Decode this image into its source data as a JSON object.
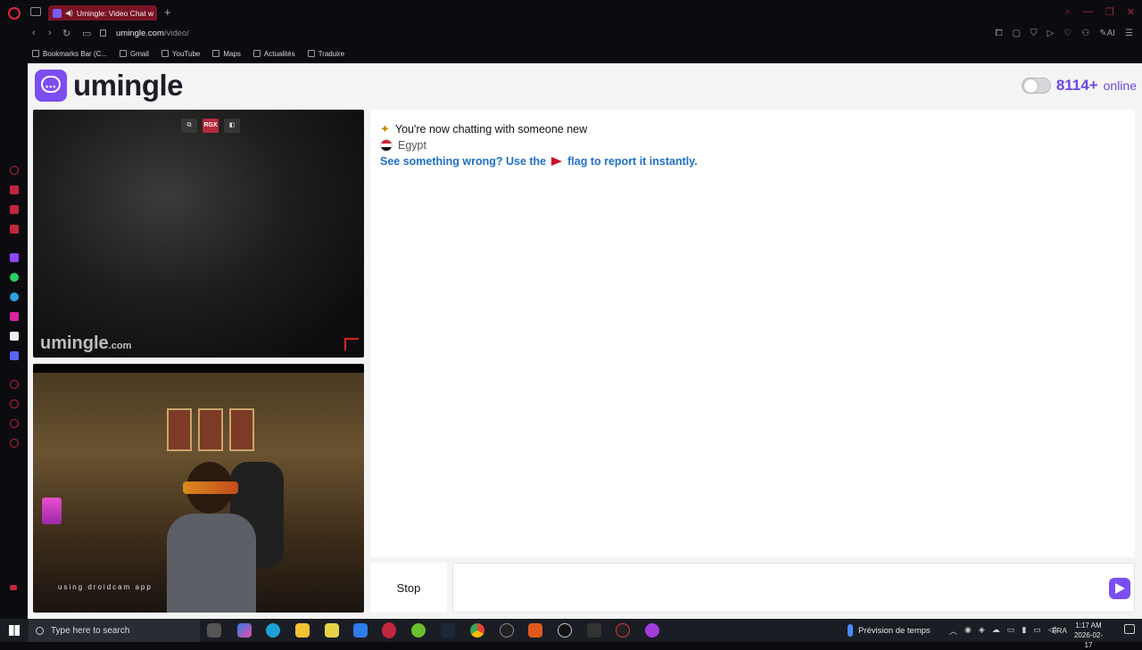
{
  "browser": {
    "tab_title": "Umingle: Video Chat w",
    "url_host": "umingle.com",
    "url_path": "/video/",
    "bookmarks": [
      "Bookmarks Bar (C...",
      "Gmail",
      "YouTube",
      "Maps",
      "Actualités",
      "Traduire"
    ],
    "ai_label": "AI"
  },
  "site": {
    "logo_text": "umingle",
    "online_count": "8114+",
    "online_label": "online",
    "watermark": "umingle",
    "watermark_suffix": ".com",
    "remote_controls": [
      "⧉",
      "RGX",
      "◧"
    ],
    "local_caption": "using droidcam app"
  },
  "chat": {
    "line1": "You're now chatting with someone new",
    "country": "Egypt",
    "report_pre": "See something wrong? Use the",
    "report_post": "flag to report it instantly."
  },
  "controls": {
    "stop_label": "Stop",
    "message_placeholder": ""
  },
  "taskbar": {
    "search_placeholder": "Type here to search",
    "weather": "Prévision de temps",
    "language": "FRA",
    "time": "1:17 AM",
    "date": "2026-02-17"
  },
  "colors": {
    "brand": "#7b4df2",
    "link": "#1e6fc9",
    "opera_red": "#e0263f"
  }
}
